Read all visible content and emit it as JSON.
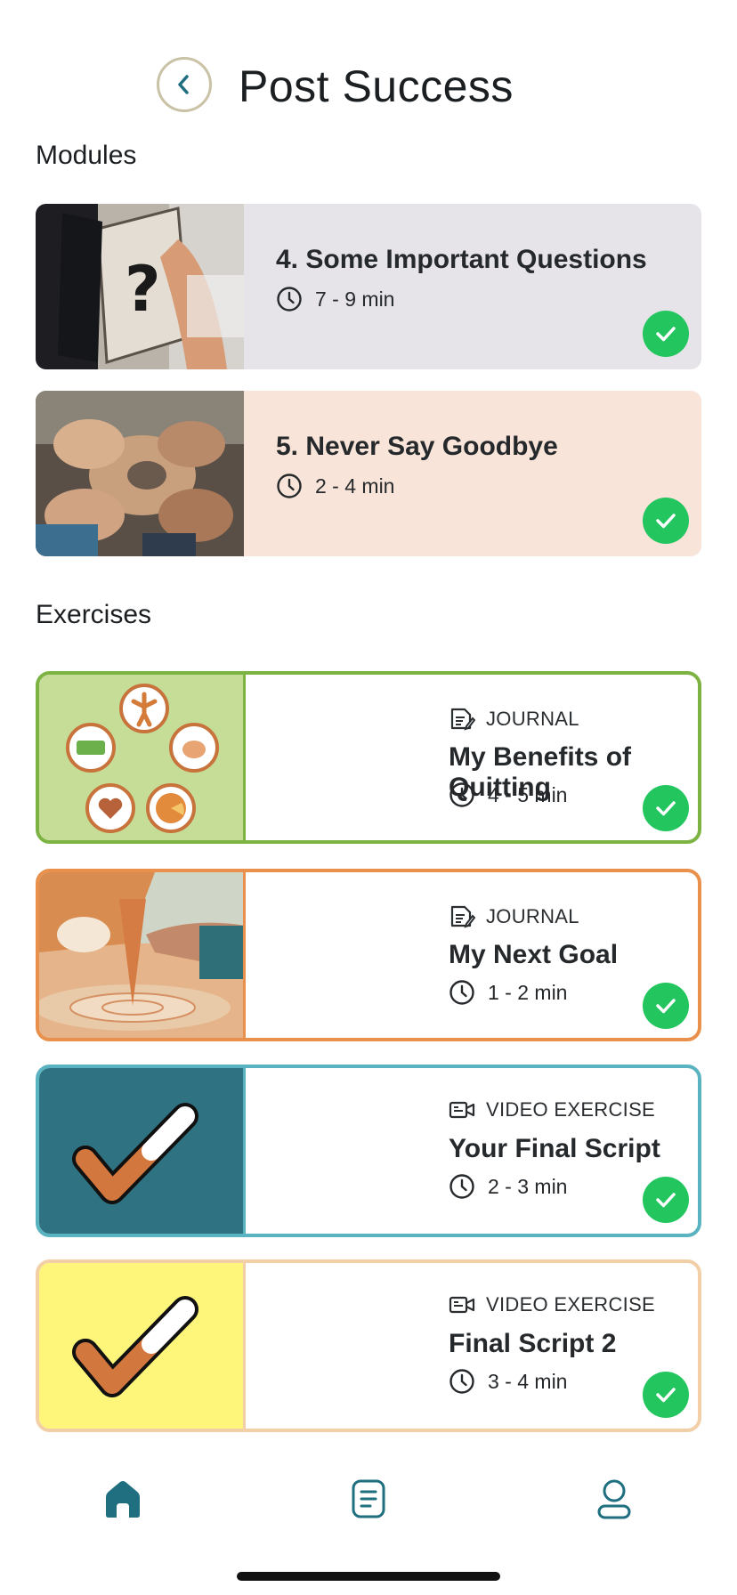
{
  "header": {
    "title": "Post Success"
  },
  "sections": {
    "modules": "Modules",
    "exercises": "Exercises"
  },
  "modules": [
    {
      "title": "4. Some Important Questions",
      "duration": "7 - 9 min",
      "bg": "#e6e4e8",
      "completed": true
    },
    {
      "title": "5. Never Say Goodbye",
      "duration": "2 - 4 min",
      "bg": "#f8e4d8",
      "completed": true
    }
  ],
  "exercises": [
    {
      "type": "JOURNAL",
      "title": "My Benefits of Quitting",
      "duration": "4 - 5 min",
      "border": "#7cb342",
      "thumb_bg": "#c5dd97",
      "icon": "journal-icon",
      "completed": true
    },
    {
      "type": "JOURNAL",
      "title": "My Next Goal",
      "duration": "1 - 2 min",
      "border": "#e8904c",
      "thumb_bg": "#e9a86e",
      "icon": "journal-icon",
      "completed": true
    },
    {
      "type": "VIDEO EXERCISE",
      "title": "Your Final Script",
      "duration": "2 - 3 min",
      "border": "#5ab3c0",
      "thumb_bg": "#2f7382",
      "icon": "video-icon",
      "completed": true
    },
    {
      "type": "VIDEO EXERCISE",
      "title": "Final Script 2",
      "duration": "3 - 4 min",
      "border": "#f2cfa6",
      "thumb_bg": "#fdf67a",
      "icon": "video-icon",
      "completed": true
    }
  ],
  "tabbar": {
    "items": [
      "home-icon",
      "document-icon",
      "profile-icon"
    ],
    "active_color": "#1f6f80"
  }
}
